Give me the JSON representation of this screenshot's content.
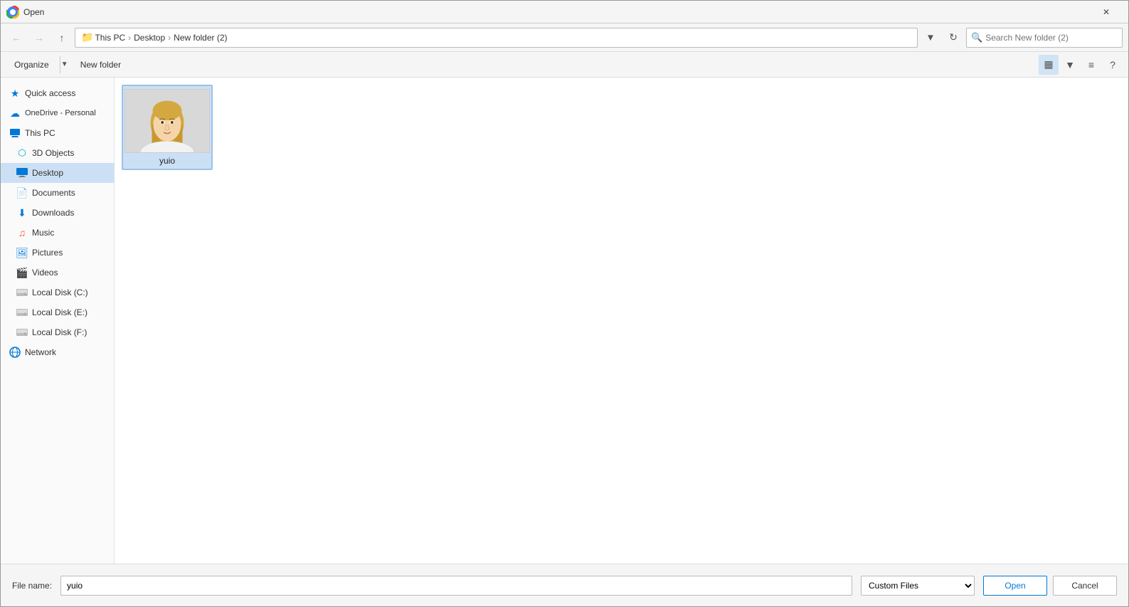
{
  "titleBar": {
    "title": "Open",
    "closeLabel": "✕",
    "iconColor": "#4285f4"
  },
  "addressBar": {
    "back": "←",
    "forward": "→",
    "up": "↑",
    "breadcrumbs": [
      "This PC",
      "Desktop",
      "New folder (2)"
    ],
    "refreshLabel": "↻",
    "searchPlaceholder": "Search New folder (2)"
  },
  "toolbar": {
    "organizeLabel": "Organize",
    "newFolderLabel": "New folder",
    "viewIcon": "▦",
    "viewPreviewIcon": "▤",
    "helpIcon": "?"
  },
  "sidebar": {
    "quickAccess": {
      "label": "Quick access",
      "icon": "⭐"
    },
    "onedrive": {
      "label": "OneDrive - Personal",
      "icon": "☁"
    },
    "thisPC": {
      "label": "This PC",
      "icon": "💻"
    },
    "items": [
      {
        "id": "3d-objects",
        "label": "3D Objects",
        "icon": "🧊",
        "indent": true
      },
      {
        "id": "desktop",
        "label": "Desktop",
        "icon": "🖥",
        "indent": true,
        "active": true
      },
      {
        "id": "documents",
        "label": "Documents",
        "icon": "📄",
        "indent": true
      },
      {
        "id": "downloads",
        "label": "Downloads",
        "icon": "⬇",
        "indent": true
      },
      {
        "id": "music",
        "label": "Music",
        "icon": "🎵",
        "indent": true
      },
      {
        "id": "pictures",
        "label": "Pictures",
        "icon": "🖼",
        "indent": true
      },
      {
        "id": "videos",
        "label": "Videos",
        "icon": "🎬",
        "indent": true
      },
      {
        "id": "local-disk-c",
        "label": "Local Disk (C:)",
        "icon": "💾",
        "indent": true
      },
      {
        "id": "local-disk-e",
        "label": "Local Disk (E:)",
        "icon": "💾",
        "indent": true
      },
      {
        "id": "local-disk-f",
        "label": "Local Disk (F:)",
        "icon": "💾",
        "indent": true
      },
      {
        "id": "network",
        "label": "Network",
        "icon": "🌐",
        "indent": false
      }
    ]
  },
  "fileGrid": {
    "items": [
      {
        "id": "yuio",
        "name": "yuio",
        "type": "image",
        "selected": true
      }
    ]
  },
  "bottomBar": {
    "fileNameLabel": "File name:",
    "fileNameValue": "yuio",
    "fileTypeValue": "Custom Files",
    "openLabel": "Open",
    "cancelLabel": "Cancel"
  }
}
